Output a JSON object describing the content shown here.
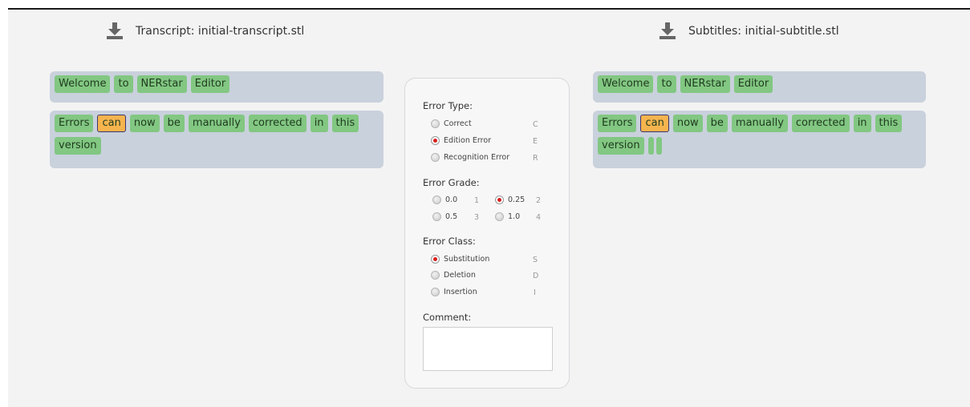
{
  "left": {
    "header": "Transcript: initial-transcript.stl",
    "icon": "download-icon",
    "row1": [
      "Welcome",
      "to",
      "NERstar",
      "Editor"
    ],
    "row2": [
      "Errors",
      "can",
      "now",
      "be",
      "manually",
      "corrected",
      "in",
      "this",
      "version"
    ]
  },
  "right": {
    "header": "Subtitles: initial-subtitle.stl",
    "icon": "download-icon",
    "row1": [
      "Welcome",
      "to",
      "NERstar",
      "Editor"
    ],
    "row2": [
      "Errors",
      "can",
      "now",
      "be",
      "manually",
      "corrected",
      "in",
      "this",
      "version"
    ]
  },
  "selected_word": "can",
  "error_panel": {
    "error_type": {
      "title": "Error Type:",
      "options": [
        {
          "label": "Correct",
          "key": "C"
        },
        {
          "label": "Edition Error",
          "key": "E",
          "selected": true
        },
        {
          "label": "Recognition Error",
          "key": "R"
        }
      ]
    },
    "error_grade": {
      "title": "Error Grade:",
      "options": [
        {
          "label": "0.0",
          "key": "1"
        },
        {
          "label": "0.25",
          "key": "2",
          "selected": true
        },
        {
          "label": "0.5",
          "key": "3"
        },
        {
          "label": "1.0",
          "key": "4"
        }
      ]
    },
    "error_class": {
      "title": "Error Class:",
      "options": [
        {
          "label": "Substitution",
          "key": "S",
          "selected": true
        },
        {
          "label": "Deletion",
          "key": "D"
        },
        {
          "label": "Insertion",
          "key": "I"
        }
      ]
    },
    "comment": {
      "title": "Comment:",
      "value": ""
    }
  },
  "colors": {
    "word_bg": "#82c782",
    "selected_word_bg": "#f6b44e",
    "panel_bg": "#c9d1dc",
    "radio_selected": "#d81d1d"
  }
}
